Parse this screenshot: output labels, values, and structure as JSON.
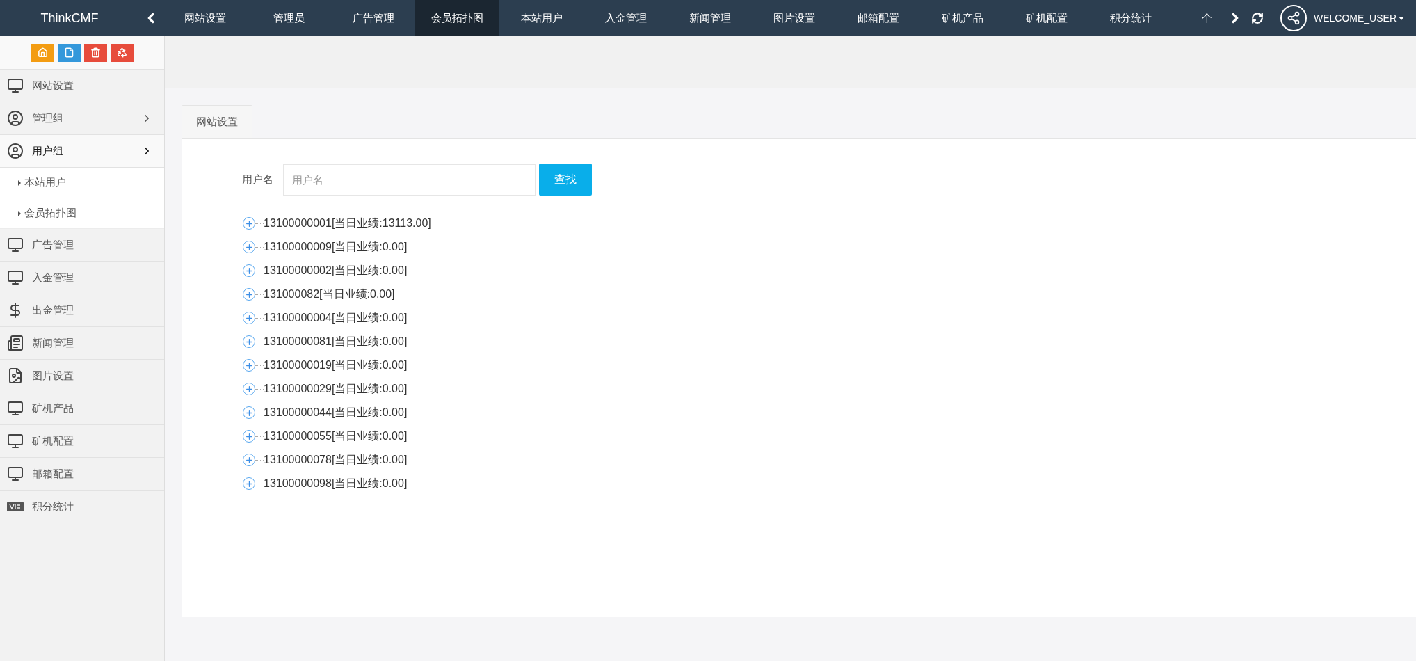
{
  "top_bar": {
    "logo": "ThinkCMF",
    "nav": [
      {
        "label": "网站设置",
        "selected": false
      },
      {
        "label": "管理员",
        "selected": false
      },
      {
        "label": "广告管理",
        "selected": false
      },
      {
        "label": "会员拓扑图",
        "selected": true
      },
      {
        "label": "本站用户",
        "selected": false
      },
      {
        "label": "入金管理",
        "selected": false
      },
      {
        "label": "新闻管理",
        "selected": false
      },
      {
        "label": "图片设置",
        "selected": false
      },
      {
        "label": "邮箱配置",
        "selected": false
      },
      {
        "label": "矿机产品",
        "selected": false
      },
      {
        "label": "矿机配置",
        "selected": false
      },
      {
        "label": "积分统计",
        "selected": false
      },
      {
        "label": "个",
        "selected": false
      }
    ],
    "user": "WELCOME_USER"
  },
  "sidebar": {
    "toolbar": [
      {
        "color": "#f39c12"
      },
      {
        "color": "#3498db"
      },
      {
        "color": "#e74c3c"
      },
      {
        "color": "#e74c3c"
      }
    ],
    "items": [
      {
        "label": "网站设置"
      },
      {
        "label": "管理组",
        "expanded": false
      },
      {
        "label": "用户组",
        "expanded": true,
        "children": [
          {
            "label": "本站用户"
          },
          {
            "label": "会员拓扑图"
          }
        ]
      },
      {
        "label": "广告管理"
      },
      {
        "label": "入金管理"
      },
      {
        "label": "出金管理"
      },
      {
        "label": "新闻管理"
      },
      {
        "label": "图片设置"
      },
      {
        "label": "矿机产品"
      },
      {
        "label": "矿机配置"
      },
      {
        "label": "邮箱配置"
      },
      {
        "label": "积分统计"
      }
    ]
  },
  "tab": {
    "label": "网站设置"
  },
  "search": {
    "label": "用户名",
    "placeholder": "用户名",
    "button": "查找"
  },
  "tree": [
    {
      "label": "13100000001[当日业绩:13113.00]",
      "expanded": false
    },
    {
      "label": "13100000009[当日业绩:0.00]",
      "expanded": false
    },
    {
      "label": "13100000002[当日业绩:0.00]",
      "expanded": false
    },
    {
      "label": "131000082[当日业绩:0.00]",
      "expanded": false
    },
    {
      "label": "13100000004[当日业绩:0.00]",
      "expanded": false
    },
    {
      "label": "13100000081[当日业绩:0.00]",
      "expanded": false
    },
    {
      "label": "13100000019[当日业绩:0.00]",
      "expanded": false
    },
    {
      "label": "13100000029[当日业绩:0.00]",
      "expanded": false
    },
    {
      "label": "13100000044[当日业绩:0.00]",
      "expanded": false
    },
    {
      "label": "13100000055[当日业绩:0.00]",
      "expanded": false
    },
    {
      "label": "13100000078[当日业绩:0.00]",
      "expanded": false
    },
    {
      "label": "13100000098[当日业绩:0.00]",
      "expanded": false
    }
  ]
}
